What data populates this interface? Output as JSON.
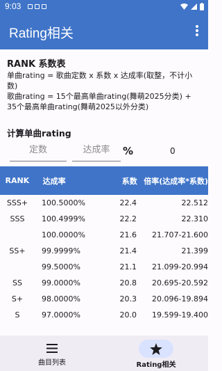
{
  "status_bar": {
    "time": "9:03",
    "icons": [
      "notification-icon",
      "notification-icon",
      "notification-icon",
      "wifi-icon",
      "signal-icon",
      "battery-icon"
    ]
  },
  "app_bar": {
    "title": "Rating相关",
    "menu_icon": "more-vert-icon",
    "color": "#3f74c8"
  },
  "info": {
    "heading": "RANK 系数表",
    "line1": "单曲rating = 歌曲定数 x 系数 x 达成率(取整，不计小数)",
    "line2": "歌曲rating = 15个最高单曲rating(舞萌2025分类) + 35个最高单曲rating(舞萌2025以外分类)"
  },
  "calculator": {
    "heading": "计算单曲rating",
    "level_placeholder": "定数",
    "achievement_placeholder": "达成率",
    "percent_symbol": "%",
    "result": "0"
  },
  "table": {
    "headers": [
      "RANK",
      "达成率",
      "系数",
      "倍率(达成率*系数)"
    ],
    "rows": [
      [
        "SSS+",
        "100.5000%",
        "22.4",
        "22.512"
      ],
      [
        "SSS",
        "100.4999%",
        "22.2",
        "22.310"
      ],
      [
        "",
        "100.0000%",
        "21.6",
        "21.707-21.600"
      ],
      [
        "SS+",
        "99.9999%",
        "21.4",
        "21.399"
      ],
      [
        "",
        "99.5000%",
        "21.1",
        "21.099-20.994"
      ],
      [
        "SS",
        "99.0000%",
        "20.8",
        "20.695-20.592"
      ],
      [
        "S+",
        "98.0000%",
        "20.3",
        "20.096-19.894"
      ],
      [
        "S",
        "97.0000%",
        "20.0",
        "19.599-19.400"
      ]
    ]
  },
  "bottom_nav": {
    "items": [
      {
        "label": "曲目列表",
        "icon": "list-icon",
        "active": false
      },
      {
        "label": "Rating相关",
        "icon": "star-icon",
        "active": true
      }
    ]
  }
}
